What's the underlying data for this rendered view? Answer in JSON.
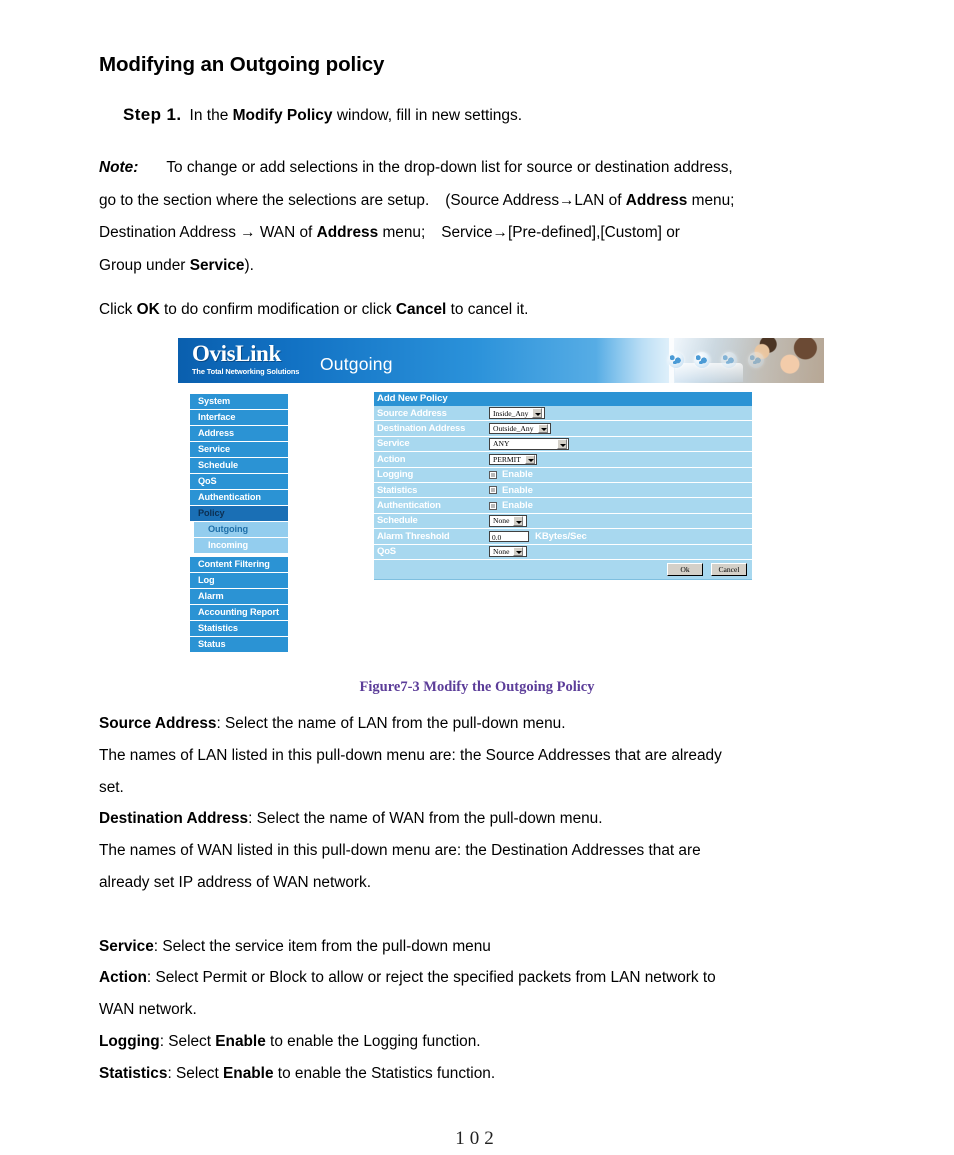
{
  "document": {
    "title": "Modifying an Outgoing policy",
    "step": {
      "label": "Step 1.",
      "text_1": "In the",
      "bold_1": "Modify Policy",
      "text_2": "window, fill in new settings."
    },
    "note": {
      "label": "Note:",
      "line1": "To change or add selections in the drop-down list for source or destination address,",
      "line2_a": "go to the section where the selections are setup.",
      "line2_b": "(Source Address→LAN of",
      "line2_bold": "Address",
      "line2_c": "menu;",
      "line3_a": "Destination Address",
      "line3_arrow": "→",
      "line3_b": "WAN of",
      "line3_bold": "Address",
      "line3_c": "menu;",
      "line3_d": "Service→[Pre-defined],[Custom] or",
      "line4_a": "Group under",
      "line4_bold": "Service",
      "line4_b": ")."
    },
    "click_line": {
      "a": "Click",
      "bold_ok": "OK",
      "b": "to do confirm modification or click",
      "bold_cancel": "Cancel",
      "c": "to cancel it."
    },
    "figure_caption": "Figure7-3 Modify the Outgoing Policy",
    "descriptions": [
      {
        "term": "Source Address",
        "rest": ": Select the name of LAN from the pull-down menu."
      },
      {
        "term": "",
        "rest": "The names of LAN listed in this pull-down menu are: the Source Addresses that are already"
      },
      {
        "term": "",
        "rest": "set."
      },
      {
        "term": "Destination Address",
        "rest": ": Select the name of WAN from the pull-down menu."
      },
      {
        "term": "",
        "rest": "The names of WAN listed in this pull-down menu are: the Destination Addresses that are"
      },
      {
        "term": "",
        "rest": "already set IP address of WAN network."
      },
      {
        "term": "",
        "rest": ""
      },
      {
        "term": "Service",
        "rest": ": Select the service item from the pull-down menu"
      },
      {
        "term": "Action",
        "rest": ": Select Permit or Block to allow or reject the specified packets from LAN network to"
      },
      {
        "term": "",
        "rest": "WAN network."
      }
    ],
    "logging_line": {
      "term": "Logging",
      "a": ": Select",
      "bold": "Enable",
      "b": "to enable the Logging function."
    },
    "statistics_line": {
      "term": "Statistics",
      "a": ": Select",
      "bold": "Enable",
      "b": "to enable the Statistics function."
    },
    "page_number": "102"
  },
  "screenshot": {
    "brand": {
      "name": "OvisLink",
      "tagline": "The Total Networking Solutions"
    },
    "page_title": "Outgoing",
    "sidebar": [
      {
        "label": "System",
        "type": "main"
      },
      {
        "label": "Interface",
        "type": "main"
      },
      {
        "label": "Address",
        "type": "main"
      },
      {
        "label": "Service",
        "type": "main"
      },
      {
        "label": "Schedule",
        "type": "main"
      },
      {
        "label": "QoS",
        "type": "main"
      },
      {
        "label": "Authentication",
        "type": "main"
      },
      {
        "label": "Policy",
        "type": "active"
      },
      {
        "label": "Outgoing",
        "type": "sub-current"
      },
      {
        "label": "Incoming",
        "type": "sub"
      },
      {
        "label": "Content Filtering",
        "type": "main"
      },
      {
        "label": "Log",
        "type": "main"
      },
      {
        "label": "Alarm",
        "type": "main"
      },
      {
        "label": "Accounting Report",
        "type": "main"
      },
      {
        "label": "Statistics",
        "type": "main"
      },
      {
        "label": "Status",
        "type": "main"
      }
    ],
    "form": {
      "title": "Add New Policy",
      "rows": [
        {
          "label": "Source Address",
          "value": "Inside_Any"
        },
        {
          "label": "Destination Address",
          "value": "Outside_Any"
        },
        {
          "label": "Service",
          "value": "ANY"
        },
        {
          "label": "Action",
          "value": "PERMIT"
        },
        {
          "label": "Logging",
          "value": "Enable"
        },
        {
          "label": "Statistics",
          "value": "Enable"
        },
        {
          "label": "Authentication",
          "value": "Enable"
        },
        {
          "label": "Schedule",
          "value": "None"
        },
        {
          "label": "Alarm Threshold",
          "value": "0.0",
          "unit": "KBytes/Sec"
        },
        {
          "label": "QoS",
          "value": "None"
        }
      ],
      "ok_label": "Ok",
      "cancel_label": "Cancel"
    },
    "colors": {
      "nav": "#2b93d4",
      "nav_active": "#1a6fb5",
      "nav_sub": "#93cdee",
      "form_bg": "#a8d8ef",
      "header_blue": "#0a5fae",
      "caption_purple": "#5c3d99"
    }
  }
}
